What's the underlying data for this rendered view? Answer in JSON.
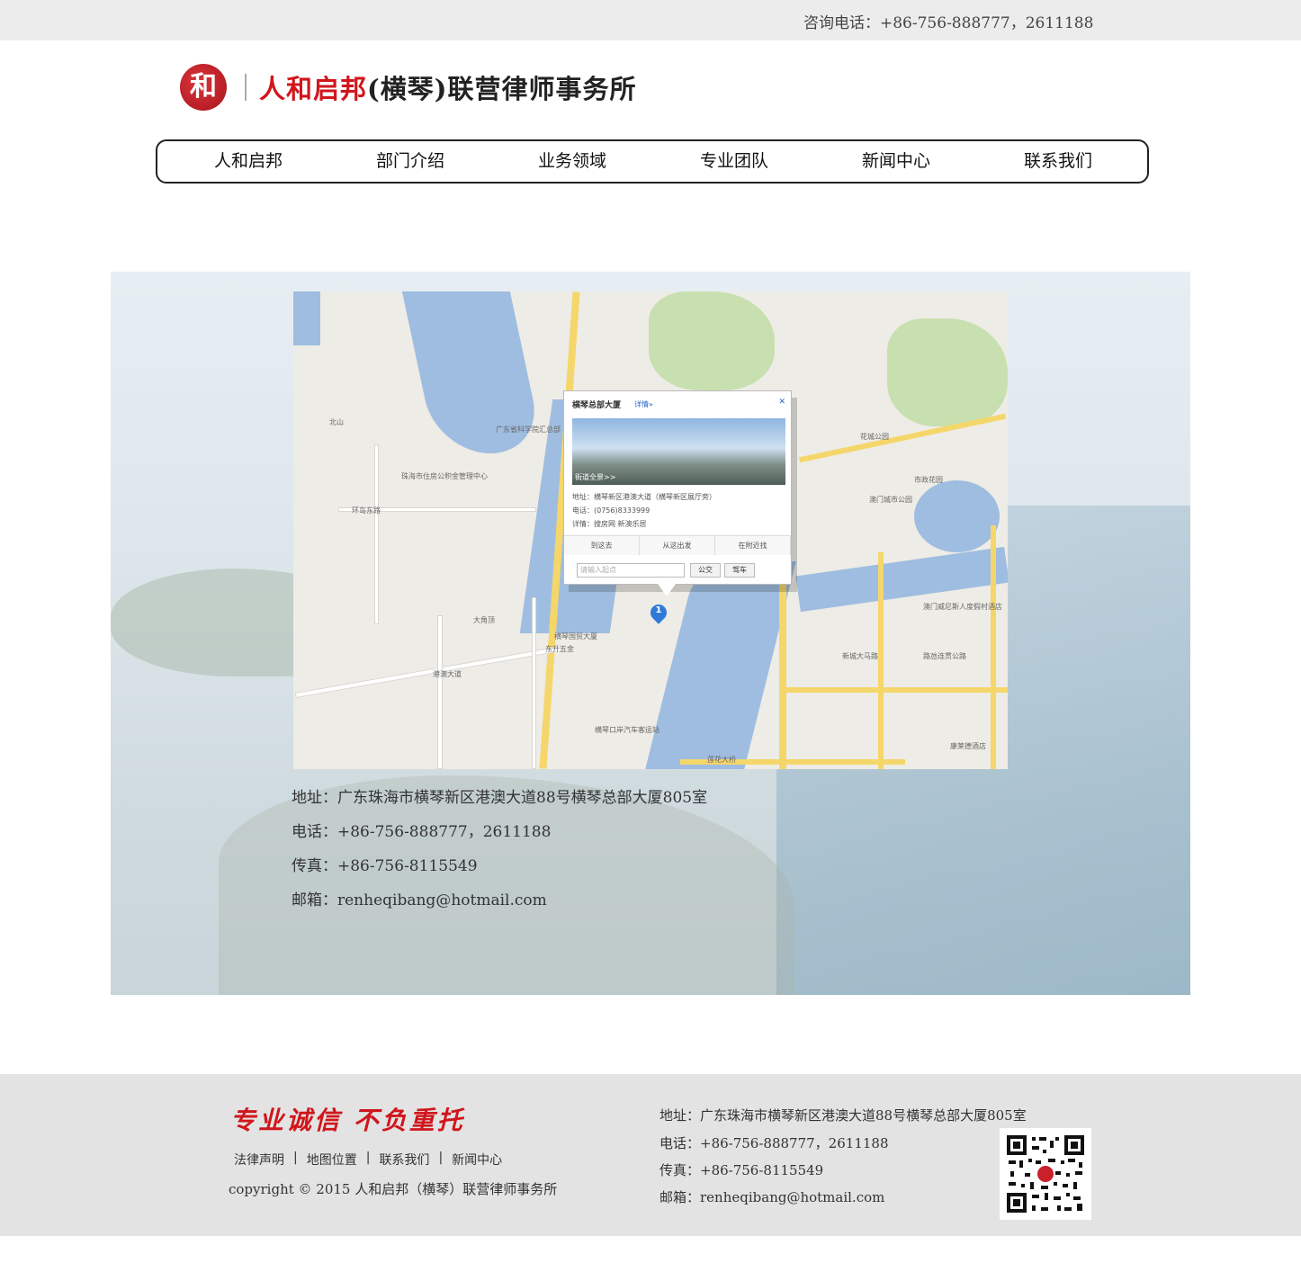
{
  "topbar": {
    "hotline": "咨询电话：+86-756-888777，2611188"
  },
  "logo": {
    "seal_char": "和",
    "name_red": "人和启邦",
    "name_dark": "(横琴)联营律师事务所"
  },
  "nav": {
    "items": [
      {
        "label": "人和启邦"
      },
      {
        "label": "部门介绍"
      },
      {
        "label": "业务领域"
      },
      {
        "label": "专业团队"
      },
      {
        "label": "新闻中心"
      },
      {
        "label": "联系我们"
      }
    ]
  },
  "map": {
    "popup": {
      "title": "横琴总部大厦",
      "detail_link": "详情»",
      "close": "✕",
      "photo_caption": "街道全景>>",
      "address": "地址：横琴新区港澳大道（横琴新区展厅旁）",
      "phone": "电话：(0756)8333999",
      "detail": "详情：搜房网  新澳乐居",
      "tabs": [
        "到这去",
        "从这出发",
        "在附近找"
      ],
      "input_placeholder": "请输入起点",
      "btn_bus": "公交",
      "btn_car": "驾车"
    },
    "marker_number": "1",
    "labels": [
      {
        "text": "北山"
      },
      {
        "text": "广东省科学院汇总部"
      },
      {
        "text": "珠海市住房公积金管理中心"
      },
      {
        "text": "环岛东路"
      },
      {
        "text": "花城公园"
      },
      {
        "text": "市政花园"
      },
      {
        "text": "澳门城市公园"
      },
      {
        "text": "大角顶"
      },
      {
        "text": "横琴国贸大厦"
      },
      {
        "text": "东升五金"
      },
      {
        "text": "港澳大道"
      },
      {
        "text": "横琴口岸汽车客运站"
      },
      {
        "text": "莲花大桥"
      },
      {
        "text": "澳门威尼斯人度假村酒店"
      },
      {
        "text": "新城大马路"
      },
      {
        "text": "路氹连贯公路"
      },
      {
        "text": "康莱德酒店"
      }
    ]
  },
  "contact": {
    "address": "地址：广东珠海市横琴新区港澳大道88号横琴总部大厦805室",
    "phone": "电话：+86-756-888777，2611188",
    "fax": "传真：+86-756-8115549",
    "email": "邮箱：renheqibang@hotmail.com"
  },
  "footer": {
    "slogan": "专业诚信 不负重托",
    "links": [
      "法律声明",
      "地图位置",
      "联系我们",
      "新闻中心"
    ],
    "copyright": "copyright © 2015 人和启邦（横琴）联营律师事务所",
    "address": "地址：广东珠海市横琴新区港澳大道88号横琴总部大厦805室",
    "phone": "电话：+86-756-888777，2611188",
    "fax": "传真：+86-756-8115549",
    "email": "邮箱：renheqibang@hotmail.com"
  },
  "colors": {
    "brand_red": "#d0161c",
    "topbar_bg": "#ececec",
    "footer_bg": "#e3e3e3"
  },
  "icons": {
    "qr_code": "qr-code-icon",
    "map_marker": "map-marker-icon"
  }
}
